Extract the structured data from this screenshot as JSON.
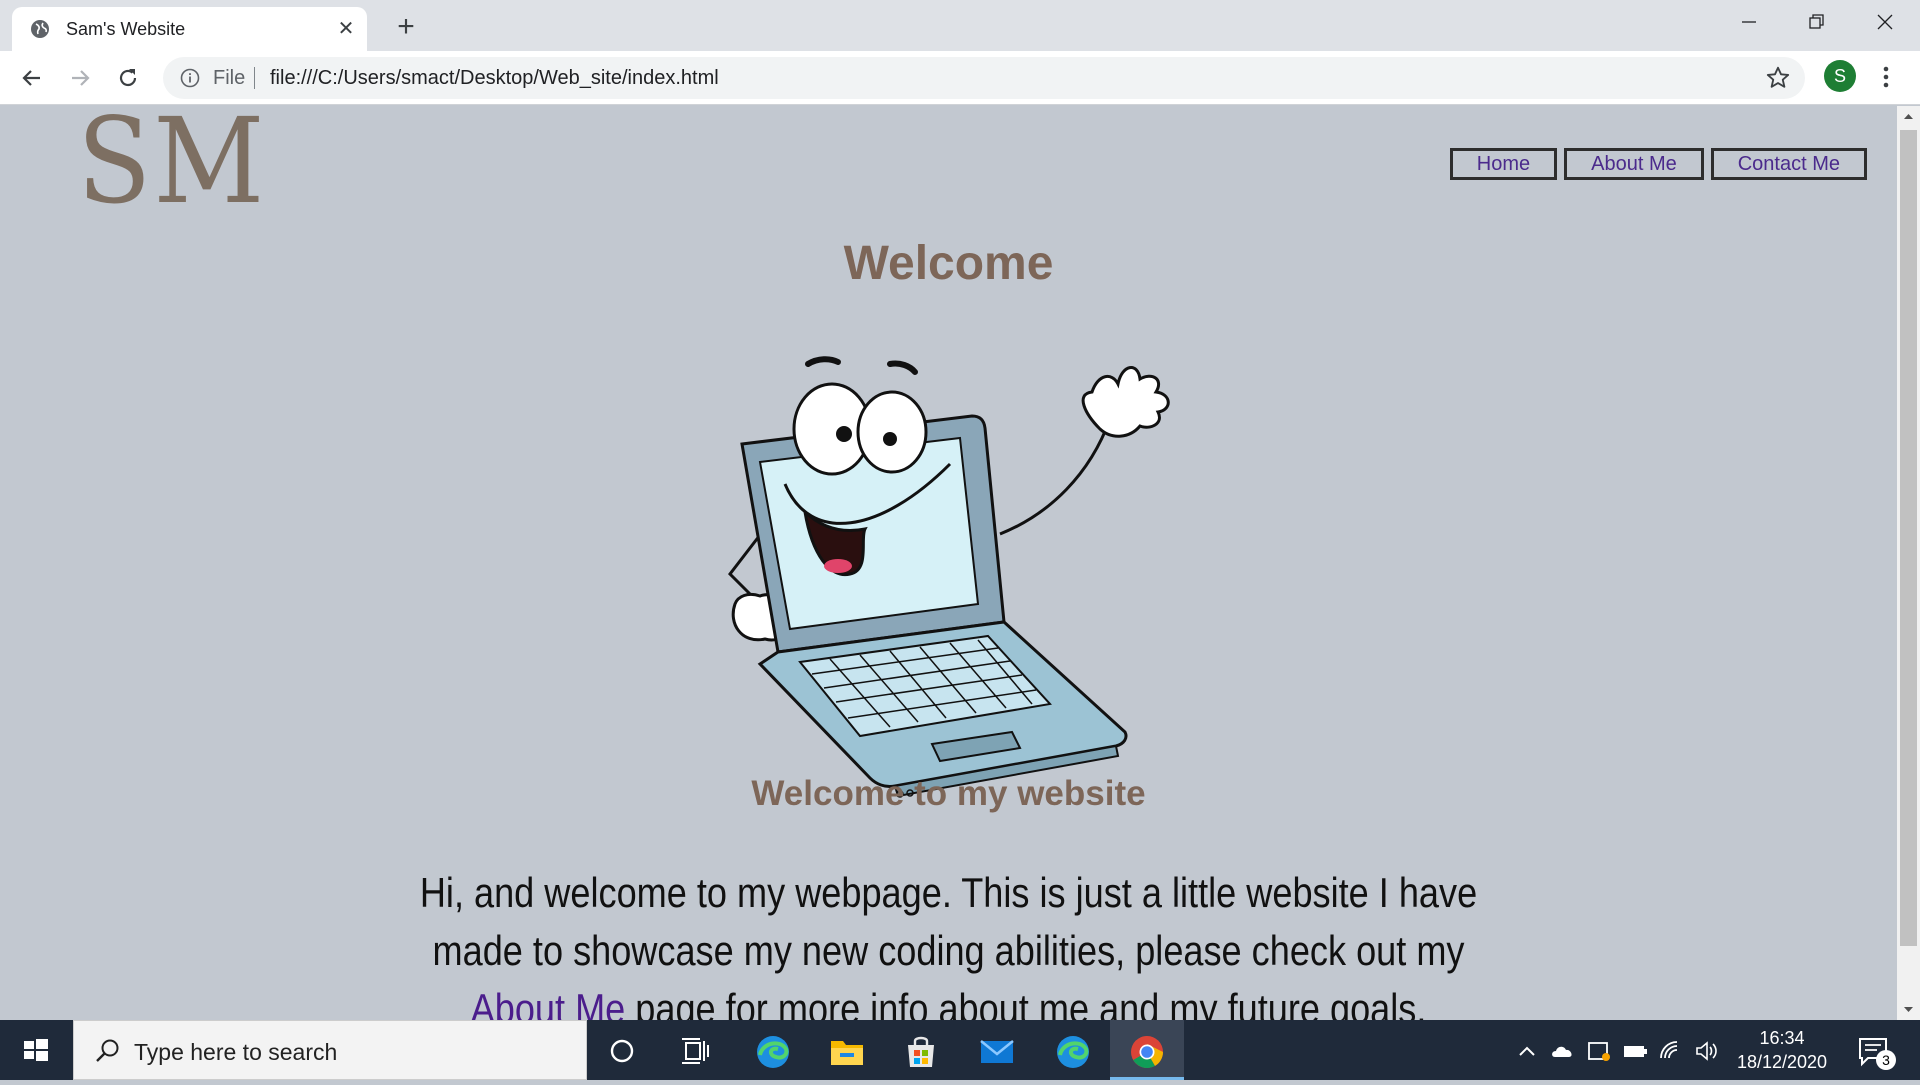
{
  "browser": {
    "tab_title": "Sam's Website",
    "tab_close": "✕",
    "new_tab": "+",
    "scheme_label": "File",
    "url": "file:///C:/Users/smact/Desktop/Web_site/index.html",
    "profile_initial": "S"
  },
  "page": {
    "logo": "SM",
    "nav": [
      "Home",
      "About Me",
      "Contact Me"
    ],
    "heading": "Welcome",
    "subheading": "Welcome to my website",
    "paragraph_before": "Hi, and welcome to my webpage. This is just a little website I have made to showcase my new coding abilities, please check out my ",
    "paragraph_link": "About Me",
    "paragraph_after": " page for more info about me and my future goals."
  },
  "taskbar": {
    "search_placeholder": "Type here to search",
    "time": "16:34",
    "date": "18/12/2020",
    "notification_count": "3",
    "pinned": [
      "cortana-icon",
      "task-view-icon",
      "edge-icon",
      "file-explorer-icon",
      "store-icon",
      "mail-icon",
      "edge-icon",
      "chrome-icon"
    ]
  },
  "colors": {
    "page_bg": "#c2c8d0",
    "heading": "#7d6658",
    "link": "#4b1d8c",
    "taskbar": "#1f2a3a"
  }
}
